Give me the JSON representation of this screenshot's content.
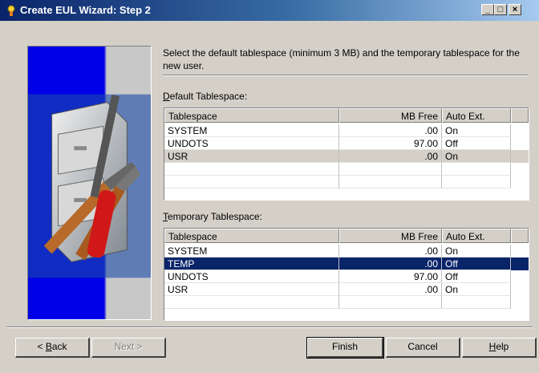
{
  "window": {
    "title": "Create EUL Wizard: Step 2",
    "icon": "wizard-icon"
  },
  "titlebar_buttons": {
    "minimize": "_",
    "maximize": "□",
    "close": "×"
  },
  "instruction": "Select the default tablespace (minimum 3 MB) and the temporary tablespace for the new user.",
  "default_ts": {
    "label_accel": "D",
    "label_rest": "efault Tablespace:",
    "columns": [
      "Tablespace",
      "MB Free",
      "Auto Ext."
    ],
    "rows": [
      [
        "SYSTEM",
        ".00",
        "On"
      ],
      [
        "UNDOTS",
        "97.00",
        "Off"
      ],
      [
        "USR",
        ".00",
        "On"
      ]
    ]
  },
  "temp_ts": {
    "label_accel": "T",
    "label_rest": "emporary Tablespace:",
    "columns": [
      "Tablespace",
      "MB Free",
      "Auto Ext."
    ],
    "rows": [
      [
        "SYSTEM",
        ".00",
        "On"
      ],
      [
        "TEMP",
        ".00",
        "Off"
      ],
      [
        "UNDOTS",
        "97.00",
        "Off"
      ],
      [
        "USR",
        ".00",
        "On"
      ]
    ]
  },
  "buttons": {
    "back_prefix": "< ",
    "back_accel": "B",
    "back_rest": "ack",
    "next_label": "Next >",
    "finish": "Finish",
    "cancel": "Cancel",
    "help_accel": "H",
    "help_rest": "elp"
  },
  "colors": {
    "selection": "#0a246a",
    "face": "#d4d0c8"
  }
}
